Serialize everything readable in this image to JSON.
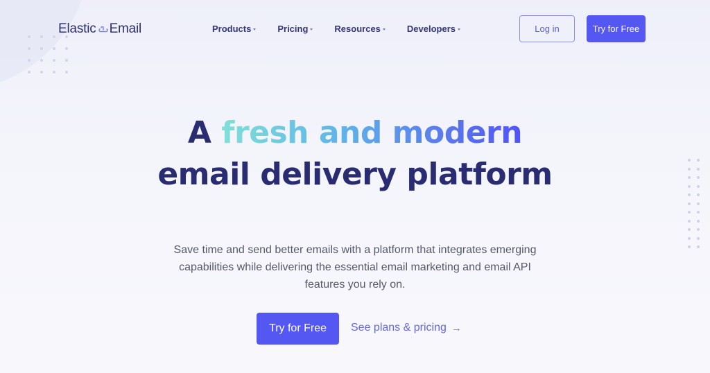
{
  "brand": {
    "name_left": "Elastic",
    "name_right": "Email",
    "logo_icon": "link-cloud-icon"
  },
  "nav": {
    "items": [
      {
        "label": "Products",
        "icon": "caret-down-icon"
      },
      {
        "label": "Pricing",
        "icon": "caret-down-icon"
      },
      {
        "label": "Resources",
        "icon": "caret-down-icon"
      },
      {
        "label": "Developers",
        "icon": "caret-down-icon"
      }
    ],
    "login_label": "Log in",
    "try_label": "Try for Free"
  },
  "hero": {
    "title_line1_prefix": "A",
    "title_line1_highlight": "fresh and modern",
    "title_line2": "email delivery platform",
    "subtitle": "Save time and send better emails with a platform that integrates emerging capabilities while delivering the essential email marketing and email API features you rely on.",
    "cta_primary": "Try for Free",
    "cta_secondary": "See plans & pricing",
    "cta_secondary_icon": "→"
  },
  "colors": {
    "primary": "#5457f2",
    "heading": "#2a2c72",
    "gradient_start": "#7fe0d8",
    "gradient_end": "#5155f5",
    "link": "#6366e6"
  }
}
